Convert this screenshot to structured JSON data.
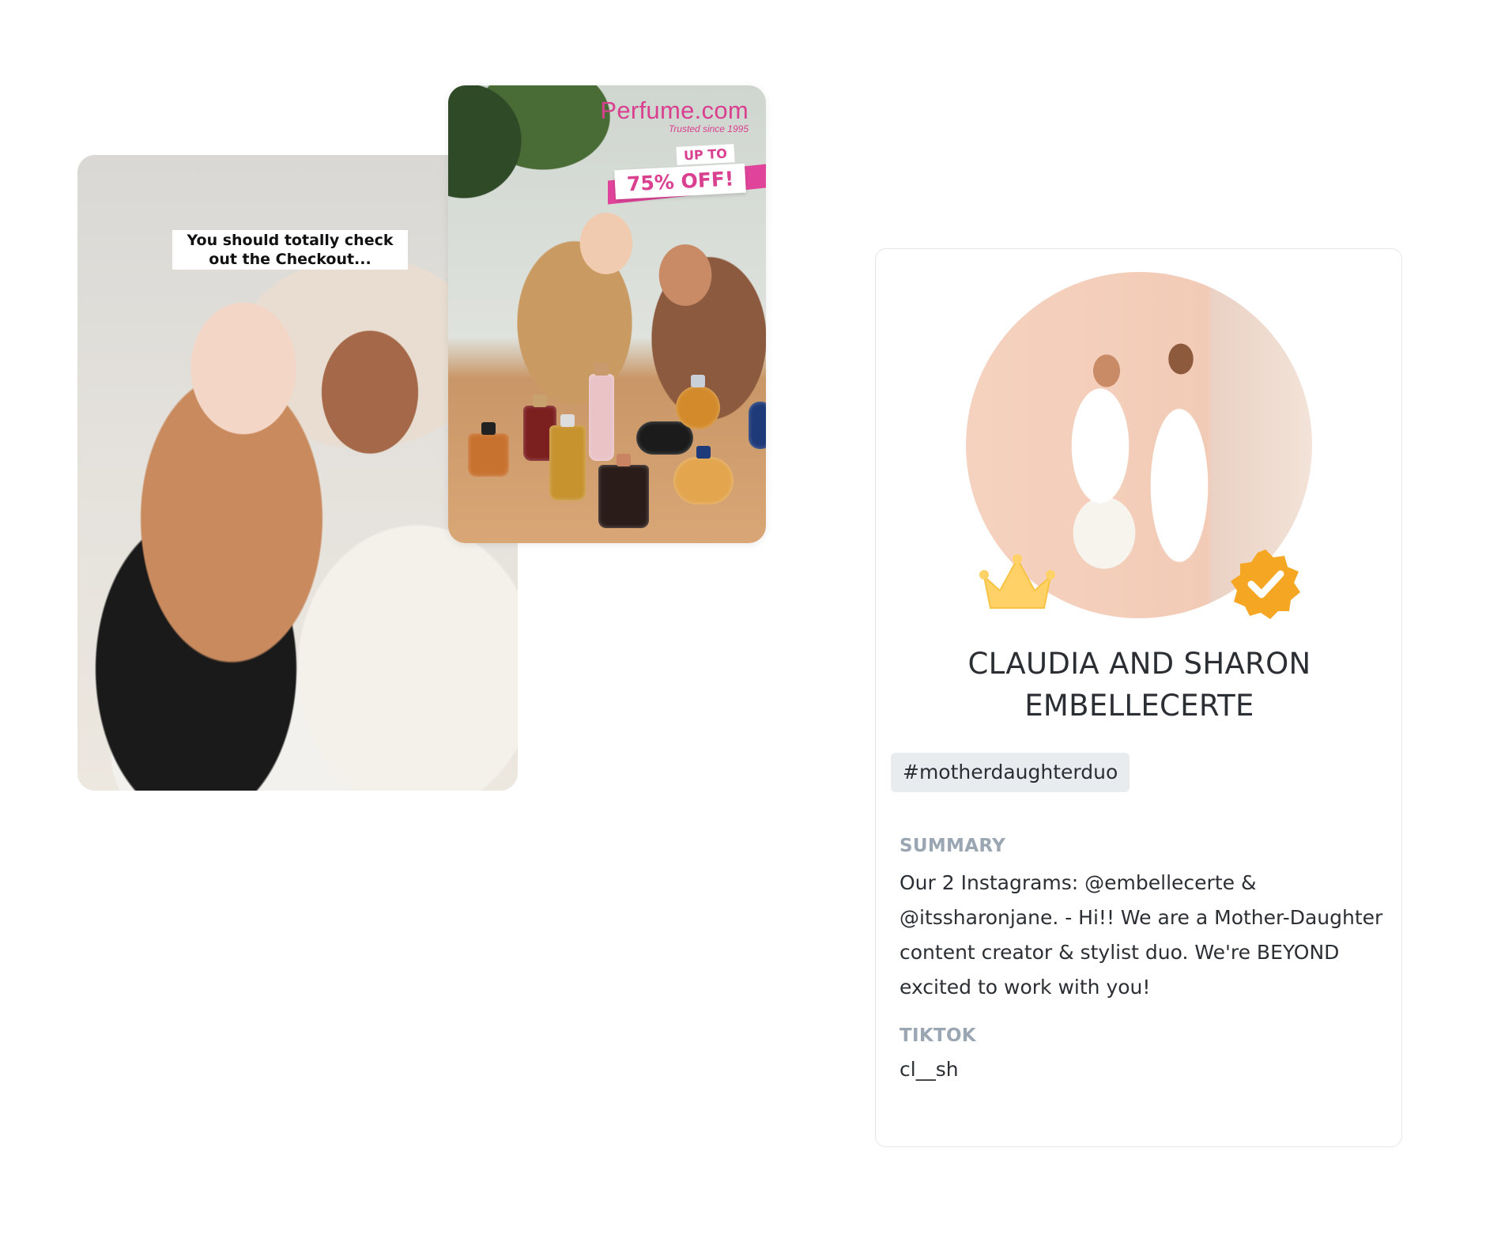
{
  "video_card": {
    "caption": "You should totally check out the Checkout..."
  },
  "ad_card": {
    "brand_name": "Perfume.com",
    "brand_tagline": "Trusted since 1995",
    "promo_prefix": "UP TO",
    "promo_offer": "75% OFF!"
  },
  "profile": {
    "name_line1": "CLAUDIA AND SHARON",
    "name_line2": "EMBELLECERTE",
    "hashtag": "#motherdaughterduo",
    "summary_label": "SUMMARY",
    "summary_text": "Our 2 Instagrams: @embellecerte & @itssharonjane. - Hi!! We are a Mother-Daughter content creator & stylist duo. We're BEYOND excited to work with you!",
    "tiktok_label": "TIKTOK",
    "tiktok_handle": "cl__sh",
    "badges": [
      "crown-icon",
      "verified-icon"
    ]
  },
  "colors": {
    "brand_pink": "#d9408f",
    "label_gray": "#9aa6b2",
    "text_dark": "#2b2f33",
    "badge_gold": "#f5a623",
    "crown_yellow": "#ffd166"
  }
}
